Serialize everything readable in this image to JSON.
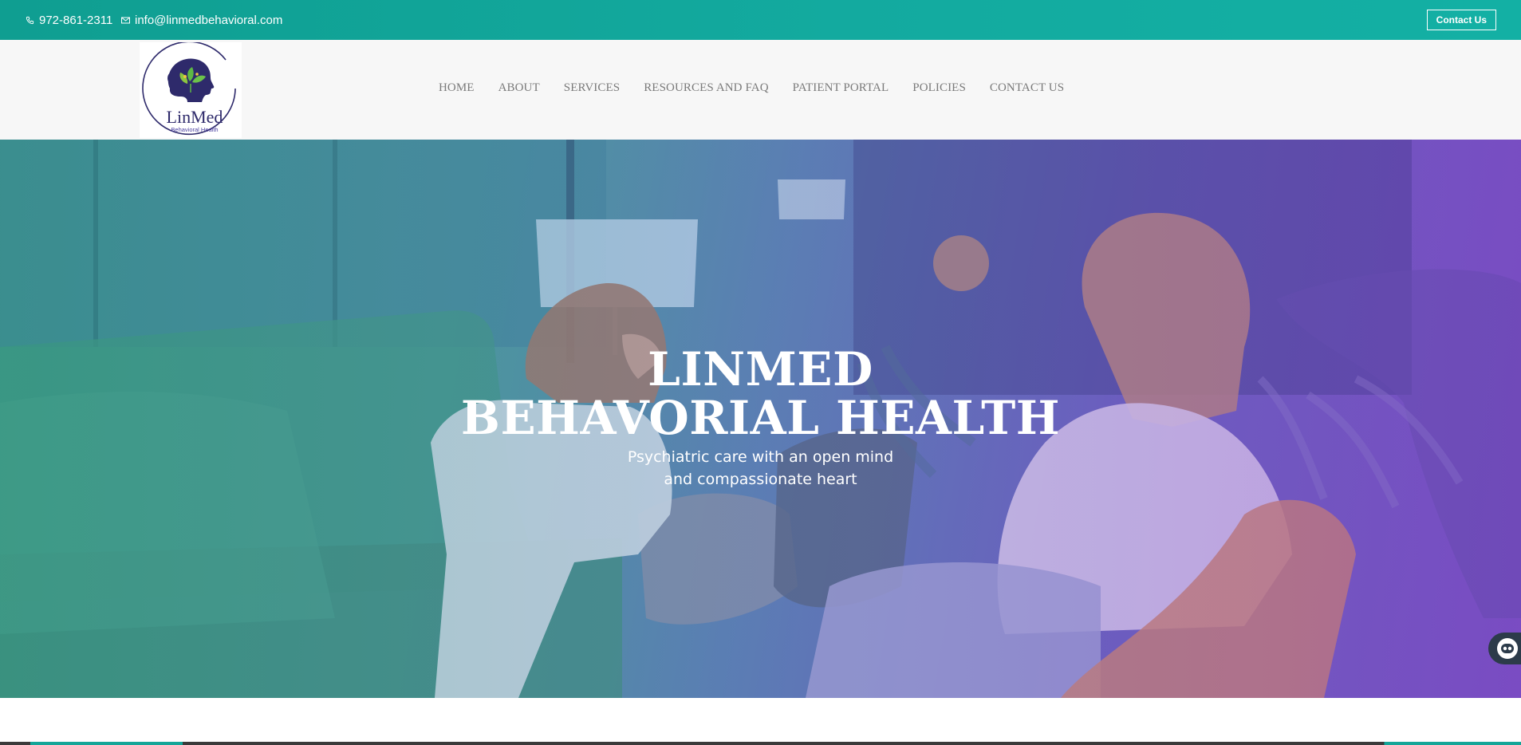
{
  "topbar": {
    "phone": "972-861-2311",
    "email": "info@linmedbehavioral.com",
    "contact_button": "Contact Us",
    "icons": {
      "phone": "phone-icon",
      "email": "mail-icon"
    }
  },
  "header": {
    "logo": {
      "name": "LinMed",
      "tagline": "Behavioral Health"
    },
    "nav": [
      {
        "label": "HOME"
      },
      {
        "label": "ABOUT"
      },
      {
        "label": "SERVICES"
      },
      {
        "label": "RESOURCES AND FAQ"
      },
      {
        "label": "PATIENT PORTAL"
      },
      {
        "label": "POLICIES"
      },
      {
        "label": "CONTACT US"
      }
    ]
  },
  "hero": {
    "title_line1": "LINMED",
    "title_line2": "BEHAVORIAL HEALTH",
    "subtitle_line1": "Psychiatric care with an open mind",
    "subtitle_line2": "and compassionate heart"
  },
  "chat_widget": {
    "icon": "chat-bot-icon"
  },
  "colors": {
    "topbar": "#13aa9f",
    "header_bg": "#f7f7f7",
    "nav_text": "#7a7a7a",
    "logo_navy": "#2e2a6b",
    "logo_green": "#5db845",
    "hero_teal": "#3f9e8d",
    "hero_purple": "#7a4fc2"
  }
}
